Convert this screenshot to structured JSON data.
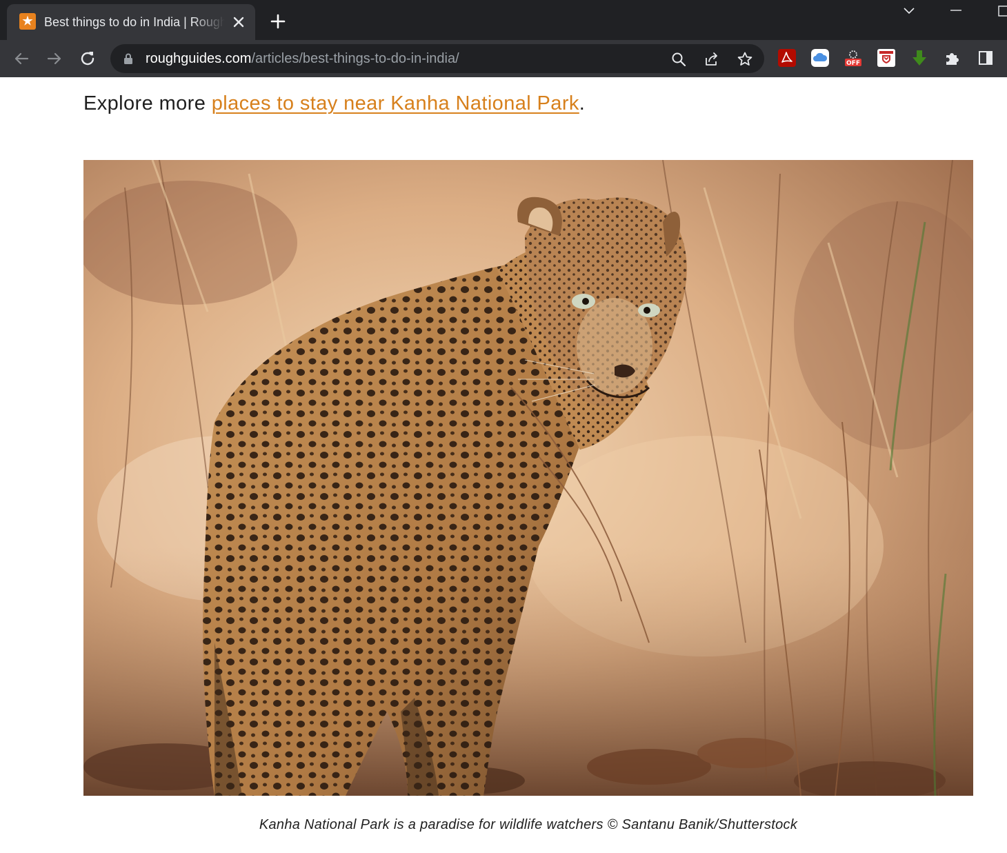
{
  "browser": {
    "tab": {
      "title": "Best things to do in India | Rough Guides",
      "favicon_glyph": "★"
    },
    "address_bar": {
      "host": "roughguides.com",
      "path": "/articles/best-things-to-do-in-india/"
    },
    "extensions": {
      "off_badge": "OFF"
    }
  },
  "article": {
    "explore_prefix": "Explore more ",
    "explore_link": "places to stay near Kanha National Park",
    "explore_suffix": ".",
    "image": {
      "subject": "leopard-in-dry-grass",
      "caption": "Kanha National Park is a paradise for wildlife watchers © Santanu Banik/Shutterstock"
    }
  },
  "colors": {
    "link": "#d7801c",
    "chrome_dark": "#202124",
    "chrome_toolbar": "#35363a",
    "favicon": "#e8821e"
  }
}
